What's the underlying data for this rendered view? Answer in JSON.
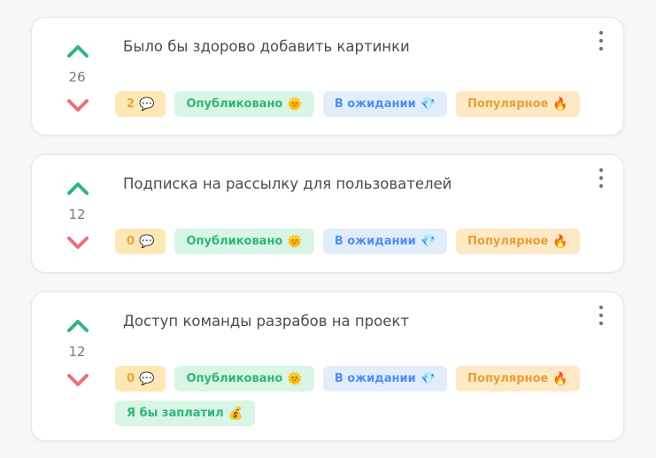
{
  "colors": {
    "upvote": "#2fb67a",
    "downvote": "#ea6f78",
    "comments_bg": "#fde7b4",
    "published_bg": "#d8f5e6",
    "waiting_bg": "#e2edfc",
    "popular_bg": "#fde9c6"
  },
  "posts": [
    {
      "title": "Было бы здорово добавить картинки",
      "votes": "26",
      "comments": "2",
      "comments_icon": "💬",
      "published": "Опубликовано",
      "published_icon": "🌞",
      "waiting": "В ожидании",
      "waiting_icon": "💎",
      "popular": "Популярное",
      "popular_icon": "🔥"
    },
    {
      "title": "Подписка на рассылку для пользователей",
      "votes": "12",
      "comments": "0",
      "comments_icon": "💬",
      "published": "Опубликовано",
      "published_icon": "🌞",
      "waiting": "В ожидании",
      "waiting_icon": "💎",
      "popular": "Популярное",
      "popular_icon": "🔥"
    },
    {
      "title": "Доступ команды разрабов на проект",
      "votes": "12",
      "comments": "0",
      "comments_icon": "💬",
      "published": "Опубликовано",
      "published_icon": "🌞",
      "waiting": "В ожидании",
      "waiting_icon": "💎",
      "popular": "Популярное",
      "popular_icon": "🔥",
      "pay": "Я бы заплатил",
      "pay_icon": "💰"
    }
  ]
}
